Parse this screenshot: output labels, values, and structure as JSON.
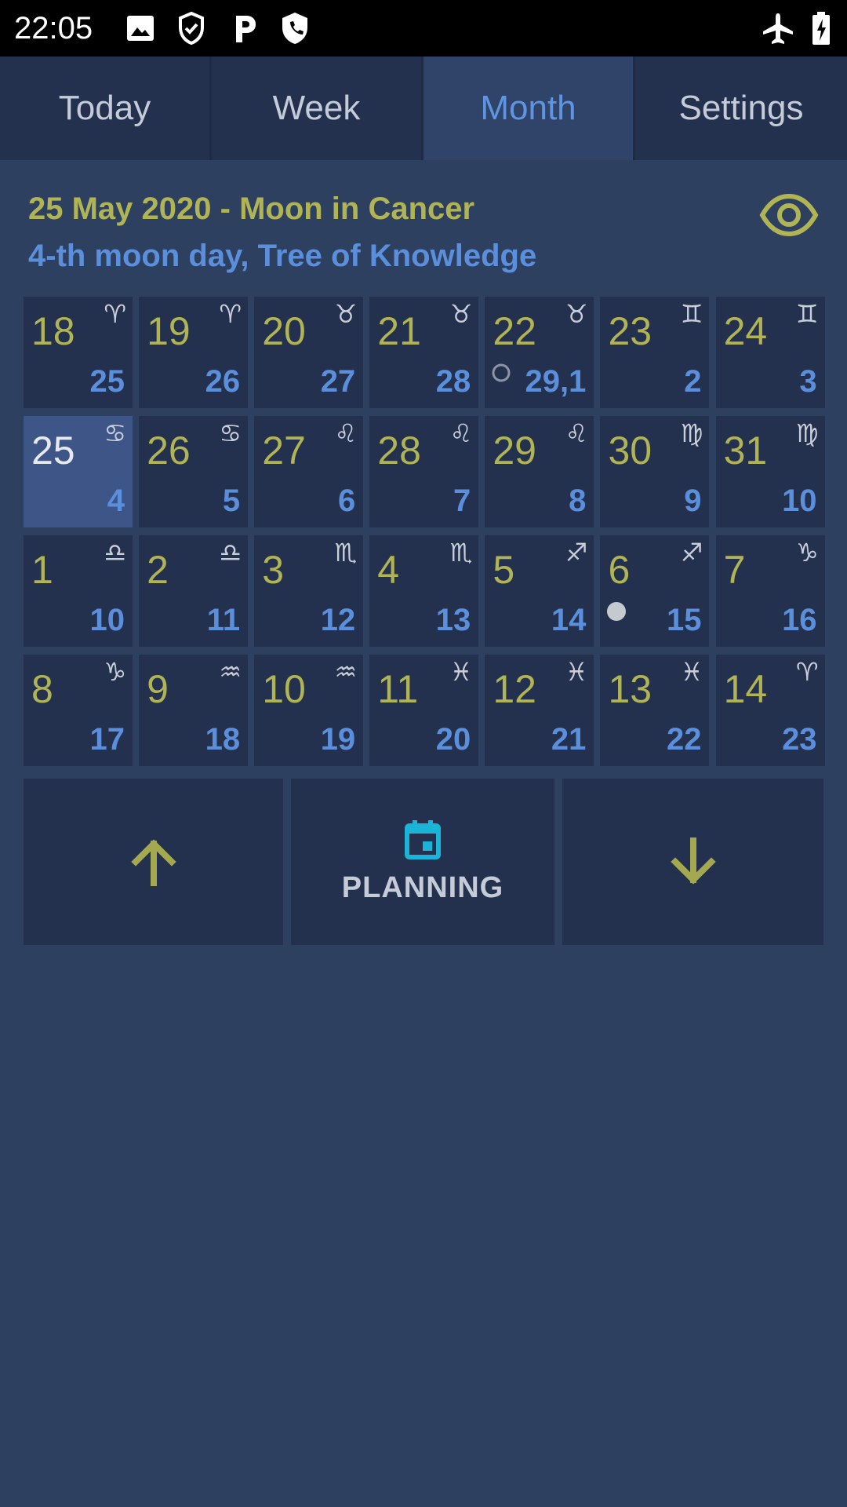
{
  "status_bar": {
    "time": "22:05",
    "left_icons": [
      "image-icon",
      "shield-check-icon",
      "parking-icon",
      "phone-shield-icon"
    ],
    "right_icons": [
      "airplane-mode-icon",
      "battery-charging-icon"
    ]
  },
  "tabs": [
    {
      "label": "Today",
      "active": false
    },
    {
      "label": "Week",
      "active": false
    },
    {
      "label": "Month",
      "active": true
    },
    {
      "label": "Settings",
      "active": false
    }
  ],
  "header": {
    "title": "25 May 2020 - Moon in Cancer",
    "subtitle": "4-th moon day, Tree of Knowledge",
    "eye_icon": "eye-icon"
  },
  "colors": {
    "background": "#2e4060",
    "cell": "#23314f",
    "selected_cell": "#3e5687",
    "day_number": "#b1b455",
    "moon_day": "#5b8fdb",
    "active_tab": "#5f95e0",
    "planning_icon": "#1ab4d6"
  },
  "calendar": {
    "days": [
      {
        "day": "18",
        "sign": "♈",
        "moon": "25"
      },
      {
        "day": "19",
        "sign": "♈",
        "moon": "26"
      },
      {
        "day": "20",
        "sign": "♉",
        "moon": "27"
      },
      {
        "day": "21",
        "sign": "♉",
        "moon": "28"
      },
      {
        "day": "22",
        "sign": "♉",
        "moon": "29,1",
        "phase": "new-moon"
      },
      {
        "day": "23",
        "sign": "♊",
        "moon": "2"
      },
      {
        "day": "24",
        "sign": "♊",
        "moon": "3"
      },
      {
        "day": "25",
        "sign": "♋",
        "moon": "4",
        "selected": true
      },
      {
        "day": "26",
        "sign": "♋",
        "moon": "5"
      },
      {
        "day": "27",
        "sign": "♌",
        "moon": "6"
      },
      {
        "day": "28",
        "sign": "♌",
        "moon": "7"
      },
      {
        "day": "29",
        "sign": "♌",
        "moon": "8"
      },
      {
        "day": "30",
        "sign": "♍",
        "moon": "9"
      },
      {
        "day": "31",
        "sign": "♍",
        "moon": "10"
      },
      {
        "day": "1",
        "sign": "♎",
        "moon": "10"
      },
      {
        "day": "2",
        "sign": "♎",
        "moon": "11"
      },
      {
        "day": "3",
        "sign": "♏",
        "moon": "12"
      },
      {
        "day": "4",
        "sign": "♏",
        "moon": "13"
      },
      {
        "day": "5",
        "sign": "♐",
        "moon": "14"
      },
      {
        "day": "6",
        "sign": "♐",
        "moon": "15",
        "phase": "full-moon"
      },
      {
        "day": "7",
        "sign": "♑",
        "moon": "16"
      },
      {
        "day": "8",
        "sign": "♑",
        "moon": "17"
      },
      {
        "day": "9",
        "sign": "♒",
        "moon": "18"
      },
      {
        "day": "10",
        "sign": "♒",
        "moon": "19"
      },
      {
        "day": "11",
        "sign": "♓",
        "moon": "20"
      },
      {
        "day": "12",
        "sign": "♓",
        "moon": "21"
      },
      {
        "day": "13",
        "sign": "♓",
        "moon": "22"
      },
      {
        "day": "14",
        "sign": "♈",
        "moon": "23"
      }
    ]
  },
  "actions": {
    "up_icon": "arrow-up-icon",
    "planning_label": "PLANNING",
    "planning_icon": "calendar-icon",
    "down_icon": "arrow-down-icon"
  }
}
